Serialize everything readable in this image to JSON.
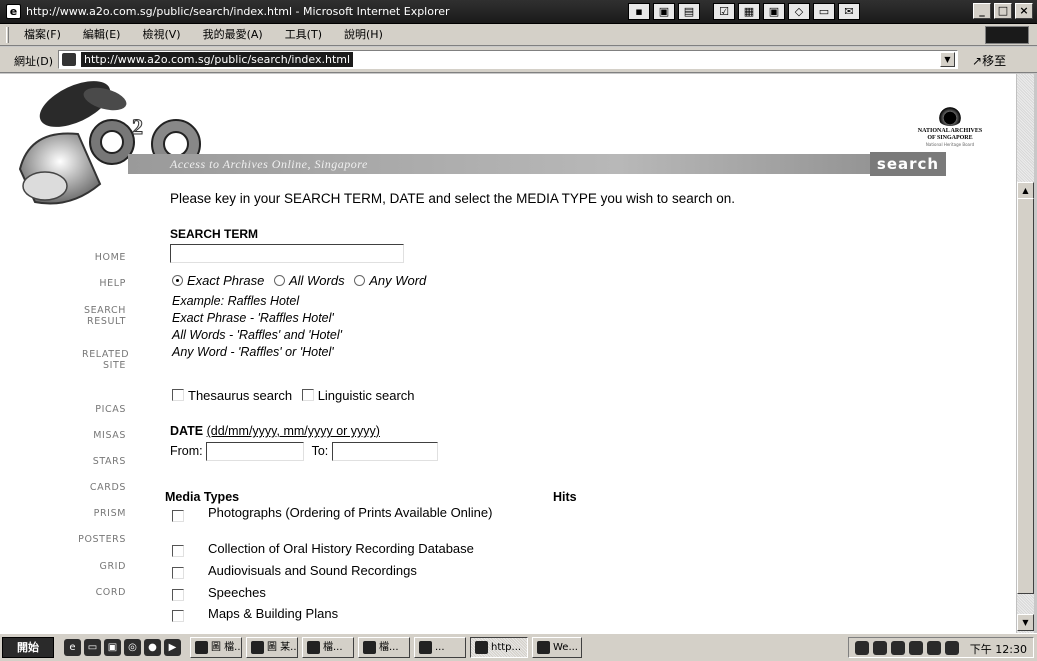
{
  "window": {
    "title": "http://www.a2o.com.sg/public/search/index.html - Microsoft Internet Explorer"
  },
  "menu": [
    "檔案(F)",
    "編輯(E)",
    "檢視(V)",
    "我的最愛(A)",
    "工具(T)",
    "說明(H)"
  ],
  "address": {
    "label": "網址(D)",
    "url": "http://www.a2o.com.sg/public/search/index.html",
    "go_label": "移至"
  },
  "banner": {
    "logo_text": "a2o",
    "tagline": "Access to Archives Online, Singapore",
    "search_tab": "search",
    "archives_name_line1": "NATIONAL ARCHIVES",
    "archives_name_line2": "OF SINGAPORE",
    "archives_name_line3": "National Heritage Board"
  },
  "nav": [
    "HOME",
    "HELP",
    "SEARCH RESULT",
    "RELATED SITE",
    "PICAS",
    "MISAS",
    "STARS",
    "CARDS",
    "PRISM",
    "POSTERS",
    "GRID",
    "CORD"
  ],
  "instructions": "Please key in your SEARCH TERM, DATE and select the MEDIA TYPE you wish to search on.",
  "search_term": {
    "label": "SEARCH TERM",
    "value": "",
    "match_options": [
      {
        "label": "Exact Phrase",
        "selected": true
      },
      {
        "label": "All Words",
        "selected": false
      },
      {
        "label": "Any Word",
        "selected": false
      }
    ],
    "examples": [
      "Example: Raffles Hotel",
      "Exact Phrase - 'Raffles Hotel'",
      "All Words - 'Raffles' and 'Hotel'",
      "Any Word - 'Raffles' or 'Hotel'"
    ]
  },
  "search_options": [
    {
      "label": "Thesaurus search",
      "checked": false
    },
    {
      "label": "Linguistic search",
      "checked": false
    }
  ],
  "date": {
    "label": "DATE",
    "format_hint": "(dd/mm/yyyy, mm/yyyy or yyyy)",
    "from_label": "From:",
    "to_label": "To:",
    "from_value": "",
    "to_value": ""
  },
  "media": {
    "header": "Media Types",
    "hits_header": "Hits",
    "types": [
      {
        "label": "Photographs (Ordering of Prints Available Online)",
        "checked": false
      },
      {
        "label": "Collection of Oral History Recording Database",
        "checked": false
      },
      {
        "label": "Audiovisuals and Sound Recordings",
        "checked": false
      },
      {
        "label": "Speeches",
        "checked": false
      },
      {
        "label": "Maps & Building Plans",
        "checked": false
      }
    ]
  },
  "taskbar": {
    "start_label": "開始",
    "tasks": [
      "圖 檔...",
      "圖 某...",
      "檔...",
      "檔...",
      "...",
      "http...",
      "We..."
    ],
    "active_task": 5,
    "clock": "下午 12:30"
  }
}
